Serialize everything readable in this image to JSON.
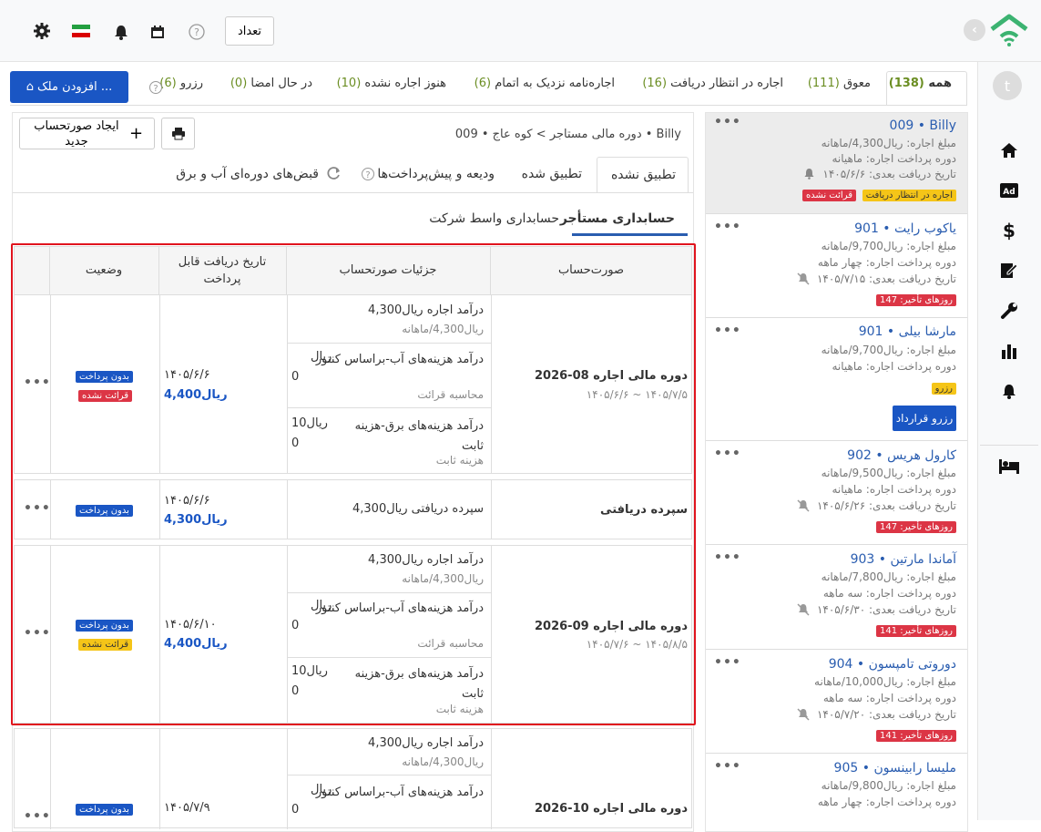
{
  "topbar": {
    "count_button": "تعداد"
  },
  "filter_tabs": [
    {
      "label": "همه",
      "count": "(138)"
    },
    {
      "label": "معوق",
      "count": "(111)"
    },
    {
      "label": "اجاره در انتظار دریافت",
      "count": "(16)"
    },
    {
      "label": "اجاره‌نامه نزدیک به اتمام",
      "count": "(6)"
    },
    {
      "label": "هنوز اجاره نشده",
      "count": "(10)"
    },
    {
      "label": "در حال امضا",
      "count": "(0)"
    },
    {
      "label": "رزرو",
      "count": "(6)"
    }
  ],
  "add_property_button": "افزودن ملک ...",
  "avatar_letter": "t",
  "breadcrumb": {
    "root": "دوره مالی مستاجر",
    "sep": ">",
    "current": "کوه عاج • 009 • Billy"
  },
  "new_invoice_button": "ایجاد صورتحساب جدید",
  "main_tabs": [
    "تطبیق نشده",
    "تطبیق شده",
    "ودیعه و پیش‌پرداخت‌ها",
    "قبض‌های دوره‌ای آب و برق"
  ],
  "sub_tabs": [
    "حسابداری مستأجر",
    "حسابداری واسط شرکت"
  ],
  "table": {
    "headers": {
      "invoice": "صورت‌حساب",
      "details": "جزئیات صورتحساب",
      "due": "تاریخ دریافت قابل پرداخت",
      "status": "وضعیت"
    },
    "rows": [
      {
        "title": "2026-08 دوره مالی اجاره",
        "period": "۱۴۰۵/۶/۶ ~ ۱۴۰۵/۷/۵",
        "date": "۱۴۰۵/۶/۶",
        "amount": "ریال4,400",
        "d1": "درآمد اجاره  ریال4,300",
        "d1s": "ریال4,300/ماهانه",
        "d2a": "درآمد هزینه‌های آب-براساس کنتور",
        "d2b": "0",
        "d2s": "محاسبه قرائت",
        "d2amt": "ریال",
        "d3a": "درآمد هزینه‌های برق-هزینه ثابت",
        "d3b": "0",
        "d3s": "هزینه ثابت",
        "d3amt": "ریال10",
        "badge1": "بدون پرداخت",
        "badge2": "قرائت نشده"
      },
      {
        "title": "سپرده دریافتی",
        "detail": "سپرده دریافتی  ریال4,300",
        "date": "۱۴۰۵/۶/۶",
        "amount": "ریال4,300",
        "badge1": "بدون پرداخت"
      },
      {
        "title": "2026-09 دوره مالی اجاره",
        "period": "۱۴۰۵/۷/۶ ~ ۱۴۰۵/۸/۵",
        "date": "۱۴۰۵/۶/۱۰",
        "amount": "ریال4,400",
        "d1": "درآمد اجاره  ریال4,300",
        "d1s": "ریال4,300/ماهانه",
        "d2a": "درآمد هزینه‌های آب-براساس کنتور",
        "d2b": "0",
        "d2s": "محاسبه قرائت",
        "d2amt": "ریال",
        "d3a": "درآمد هزینه‌های برق-هزینه ثابت",
        "d3b": "0",
        "d3s": "هزینه ثابت",
        "d3amt": "ریال10",
        "badge1": "بدون پرداخت",
        "badge2": "قرائت نشده"
      },
      {
        "title": "2026-10 دوره مالی اجاره",
        "date": "۱۴۰۵/۷/۹",
        "d1": "درآمد اجاره  ریال4,300",
        "d1s": "ریال4,300/ماهانه",
        "d2a": "درآمد هزینه‌های آب-براساس کنتور",
        "d2b": "0",
        "d2amt": "ریال",
        "badge1": "بدون پرداخت"
      }
    ]
  },
  "units": [
    {
      "title": "009 • Billy",
      "rent": "مبلغ اجاره: ریال4,300/ماهانه",
      "period": "دوره پرداخت اجاره: ماهیانه",
      "next": "تاریخ دریافت بعدی: ۱۴۰۵/۶/۶",
      "badge_a": "اجاره در انتظار دریافت",
      "badge_b": "قرائت نشده"
    },
    {
      "title": "901 • یاکوب رایت",
      "rent": "مبلغ اجاره: ریال9,700/ماهانه",
      "period": "دوره پرداخت اجاره: چهار ماهه",
      "next": "تاریخ دریافت بعدی: ۱۴۰۵/۷/۱۵",
      "badge_a": "روزهای تأخیر: 147"
    },
    {
      "title": "901 • مارشا بیلی",
      "rent": "مبلغ اجاره: ریال9,700/ماهانه",
      "period": "دوره پرداخت اجاره: ماهیانه",
      "badge_a": "رزرو",
      "button": "رزرو قرارداد"
    },
    {
      "title": "902 • کارول هریس",
      "rent": "مبلغ اجاره: ریال9,500/ماهانه",
      "period": "دوره پرداخت اجاره: ماهیانه",
      "next": "تاریخ دریافت بعدی: ۱۴۰۵/۶/۲۶",
      "badge_a": "روزهای تأخیر: 147"
    },
    {
      "title": "903 • آماندا مارتین",
      "rent": "مبلغ اجاره: ریال7,800/ماهانه",
      "period": "دوره پرداخت اجاره: سه ماهه",
      "next": "تاریخ دریافت بعدی: ۱۴۰۵/۶/۳۰",
      "badge_a": "روزهای تأخیر: 141"
    },
    {
      "title": "904 • دوروتی تامپسون",
      "rent": "مبلغ اجاره: ریال10,000/ماهانه",
      "period": "دوره پرداخت اجاره: سه ماهه",
      "next": "تاریخ دریافت بعدی: ۱۴۰۵/۷/۲۰",
      "badge_a": "روزهای تأخیر: 141"
    },
    {
      "title": "905 • ملیسا رابینسون",
      "rent": "مبلغ اجاره: ریال9,800/ماهانه",
      "period": "دوره پرداخت اجاره: چهار ماهه"
    }
  ],
  "colors": {
    "brand_green": "#3cb371",
    "primary_blue": "#1a56c4",
    "danger_red": "#dc3545",
    "warn_yellow": "#f5c518",
    "tab_green": "#6b8e23"
  }
}
